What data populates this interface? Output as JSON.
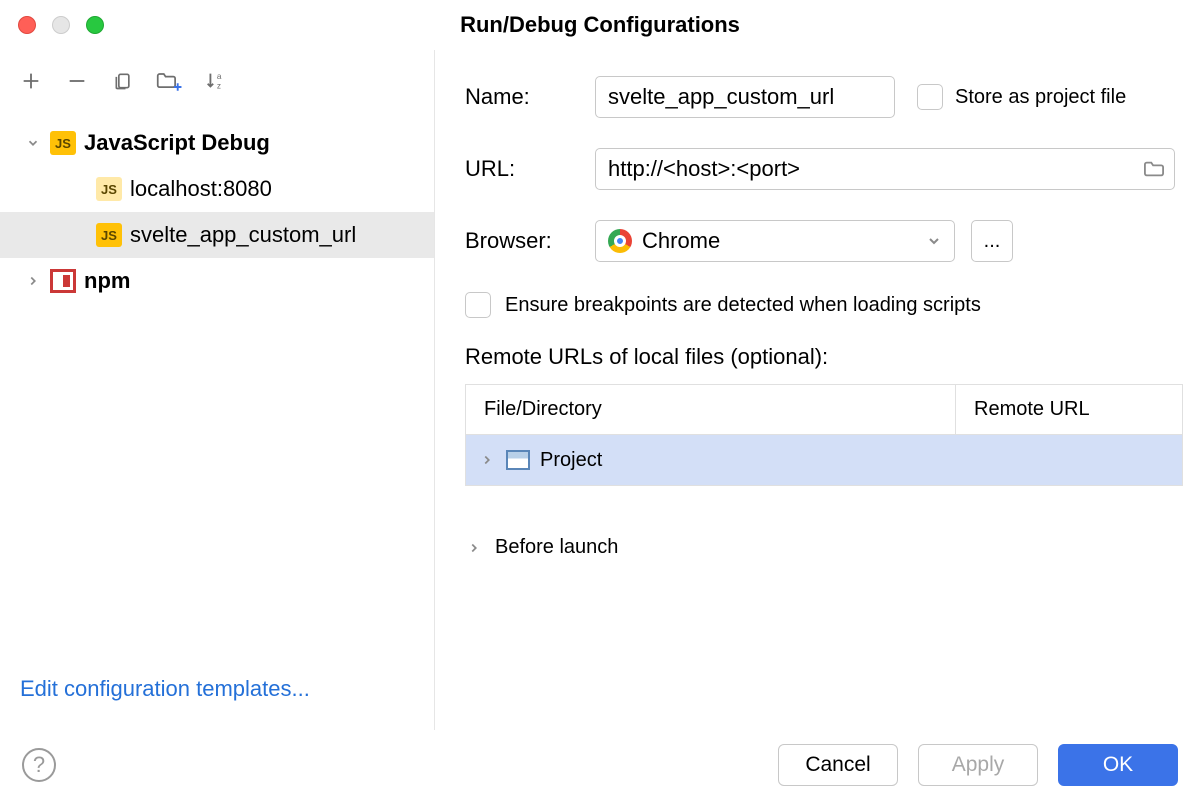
{
  "title": "Run/Debug Configurations",
  "sidebar": {
    "tree": {
      "jsDebug": {
        "label": "JavaScript Debug"
      },
      "item1": {
        "label": "localhost:8080"
      },
      "item2": {
        "label": "svelte_app_custom_url"
      },
      "npm": {
        "label": "npm"
      }
    },
    "editTemplates": "Edit configuration templates..."
  },
  "form": {
    "nameLabel": "Name:",
    "nameValue": "svelte_app_custom_url",
    "storeLabel": "Store as project file",
    "urlLabel": "URL:",
    "urlValue": "http://<host>:<port>",
    "browserLabel": "Browser:",
    "browserValue": "Chrome",
    "moreBtn": "...",
    "ensureLabel": "Ensure breakpoints are detected when loading scripts",
    "remoteLabel": "Remote URLs of local files (optional):",
    "tableCol1": "File/Directory",
    "tableCol2": "Remote URL",
    "tableProject": "Project",
    "beforeLaunch": "Before launch"
  },
  "footer": {
    "cancel": "Cancel",
    "apply": "Apply",
    "ok": "OK",
    "help": "?"
  }
}
